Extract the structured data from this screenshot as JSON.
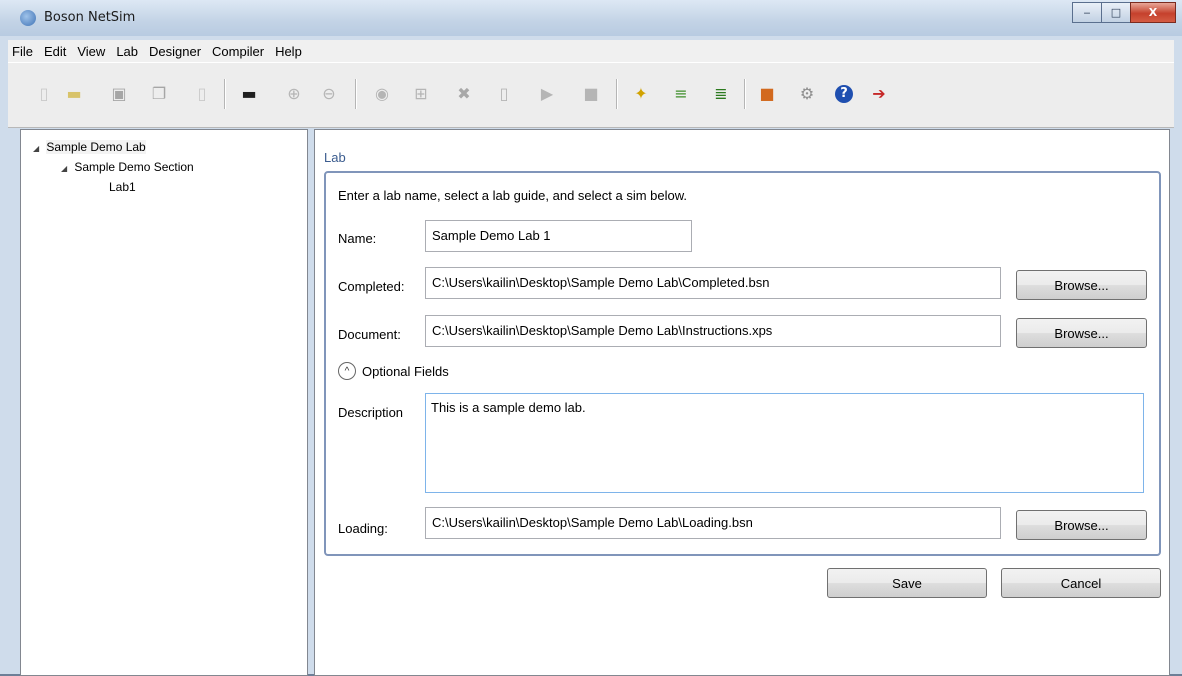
{
  "window": {
    "title": "Boson NetSim",
    "controls": {
      "minimize": "‒",
      "maximize": "□",
      "close": "X"
    }
  },
  "menu": [
    "File",
    "Edit",
    "View",
    "Lab",
    "Designer",
    "Compiler",
    "Help"
  ],
  "toolbar": {
    "buttons": [
      {
        "name": "new-file",
        "icon": "new-document-icon",
        "glyph": "▯",
        "color": "#c9c9c9",
        "enabled": false
      },
      {
        "name": "open-folder",
        "icon": "folder-icon",
        "glyph": "▬",
        "color": "#d8c36a",
        "enabled": false
      },
      {
        "name": "save",
        "icon": "save-icon",
        "glyph": "▣",
        "color": "#a6a6a6",
        "enabled": false
      },
      {
        "name": "save-all",
        "icon": "save-all-icon",
        "glyph": "❐",
        "color": "#a6a6a6",
        "enabled": false
      },
      {
        "name": "blank-page",
        "icon": "page-icon",
        "glyph": "▯",
        "color": "#c9c9c9",
        "enabled": false
      },
      {
        "name": "console",
        "icon": "console-icon",
        "glyph": "▬",
        "color": "#202020",
        "enabled": true
      },
      {
        "name": "zoom-in",
        "icon": "zoom-in-icon",
        "glyph": "⊕",
        "color": "#b5b5b5",
        "enabled": false
      },
      {
        "name": "zoom-out",
        "icon": "zoom-out-icon",
        "glyph": "⊖",
        "color": "#b5b5b5",
        "enabled": false
      },
      {
        "name": "router",
        "icon": "router-icon",
        "glyph": "◉",
        "color": "#b5b5b5",
        "enabled": false
      },
      {
        "name": "connect",
        "icon": "network-icon",
        "glyph": "⊞",
        "color": "#b5b5b5",
        "enabled": false
      },
      {
        "name": "delete",
        "icon": "delete-icon",
        "glyph": "✖",
        "color": "#a8a8a8",
        "enabled": false
      },
      {
        "name": "clear",
        "icon": "cylinder-icon",
        "glyph": "▯",
        "color": "#b5b5b5",
        "enabled": false
      },
      {
        "name": "play",
        "icon": "play-icon",
        "glyph": "▶",
        "color": "#b5b5b5",
        "enabled": false
      },
      {
        "name": "stop",
        "icon": "stop-icon",
        "glyph": "■",
        "color": "#b5b5b5",
        "enabled": false
      },
      {
        "name": "wizard",
        "icon": "magic-wand-icon",
        "glyph": "✦",
        "color": "#d1a200",
        "enabled": true
      },
      {
        "name": "compile-up",
        "icon": "compile-up-icon",
        "glyph": "≡",
        "color": "#3f8f2b",
        "enabled": true
      },
      {
        "name": "compile-down",
        "icon": "compile-down-icon",
        "glyph": "≣",
        "color": "#2c7a1f",
        "enabled": true
      },
      {
        "name": "package",
        "icon": "package-icon",
        "glyph": "■",
        "color": "#d2691e",
        "enabled": true
      },
      {
        "name": "settings",
        "icon": "gears-icon",
        "glyph": "⚙",
        "color": "#8f8f8f",
        "enabled": true
      },
      {
        "name": "help",
        "icon": "help-icon",
        "glyph": "?",
        "color": "#1f4fb0",
        "enabled": true
      },
      {
        "name": "exit",
        "icon": "exit-door-icon",
        "glyph": "➔",
        "color": "#c62828",
        "enabled": true
      }
    ]
  },
  "tree": {
    "root": {
      "label": "Sample Demo Lab",
      "arrow": "◢"
    },
    "section": {
      "label": "Sample Demo Section",
      "arrow": "◢"
    },
    "lab": {
      "label": "Lab1"
    }
  },
  "panel": {
    "section_title": "Lab",
    "instructions": "Enter a lab name, select a lab guide, and select a sim below.",
    "name": {
      "label": "Name:",
      "value": "Sample Demo Lab 1"
    },
    "completed": {
      "label": "Completed:",
      "value": "C:\\Users\\kailin\\Desktop\\Sample Demo Lab\\Completed.bsn",
      "browse": "Browse..."
    },
    "document": {
      "label": "Document:",
      "value": "C:\\Users\\kailin\\Desktop\\Sample Demo Lab\\Instructions.xps",
      "browse": "Browse..."
    },
    "optional": {
      "label": "Optional Fields",
      "icon": "^"
    },
    "description": {
      "label": "Description",
      "value": "This is a sample demo lab."
    },
    "loading": {
      "label": "Loading:",
      "value": "C:\\Users\\kailin\\Desktop\\Sample Demo Lab\\Loading.bsn",
      "browse": "Browse..."
    },
    "save": "Save",
    "cancel": "Cancel"
  }
}
